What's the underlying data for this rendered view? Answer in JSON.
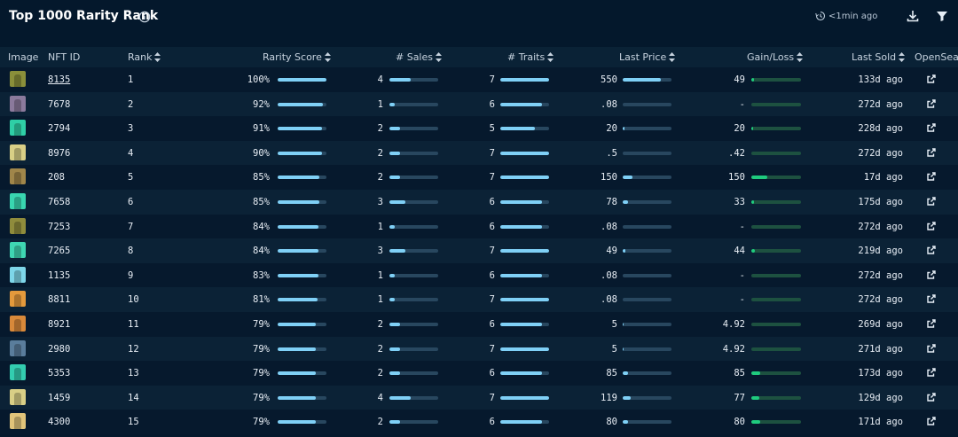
{
  "header": {
    "title": "Top 1000 Rarity Rank",
    "updated": "<1min ago",
    "icons": [
      "info-icon",
      "clock-refresh-icon",
      "download-icon",
      "filter-icon"
    ]
  },
  "columns": [
    "Image",
    "NFT ID",
    "Rank",
    "Rarity Score",
    "# Sales",
    "# Traits",
    "Last Price",
    "Gain/Loss",
    "Last Sold",
    "OpenSea"
  ],
  "colors": {
    "accent_bar": "#7fd0f6",
    "gain_bar": "#1fcb7e",
    "background": "#04182c"
  },
  "rows": [
    {
      "thumb": "#8a8f3a",
      "nft_id": "8135",
      "rank": "1",
      "score": "100%",
      "score_f": 1.0,
      "sales": "4",
      "sales_f": 0.44,
      "traits": "7",
      "traits_f": 1.0,
      "price": "550",
      "price_f": 0.78,
      "gain": "49",
      "gain_f": 0.06,
      "sold": "133d ago"
    },
    {
      "thumb": "#8b7a9c",
      "nft_id": "7678",
      "rank": "2",
      "score": "92%",
      "score_f": 0.92,
      "sales": "1",
      "sales_f": 0.11,
      "traits": "6",
      "traits_f": 0.86,
      "price": ".08",
      "price_f": 0.0,
      "gain": "-",
      "gain_f": 0.0,
      "sold": "272d ago"
    },
    {
      "thumb": "#2fcfa6",
      "nft_id": "2794",
      "rank": "3",
      "score": "91%",
      "score_f": 0.91,
      "sales": "2",
      "sales_f": 0.22,
      "traits": "5",
      "traits_f": 0.71,
      "price": "20",
      "price_f": 0.03,
      "gain": "20",
      "gain_f": 0.03,
      "sold": "228d ago"
    },
    {
      "thumb": "#d9cf86",
      "nft_id": "8976",
      "rank": "4",
      "score": "90%",
      "score_f": 0.9,
      "sales": "2",
      "sales_f": 0.22,
      "traits": "7",
      "traits_f": 1.0,
      "price": ".5",
      "price_f": 0.0,
      "gain": ".42",
      "gain_f": 0.0,
      "sold": "272d ago"
    },
    {
      "thumb": "#a0864a",
      "nft_id": "208",
      "rank": "5",
      "score": "85%",
      "score_f": 0.85,
      "sales": "2",
      "sales_f": 0.22,
      "traits": "7",
      "traits_f": 1.0,
      "price": "150",
      "price_f": 0.2,
      "gain": "150",
      "gain_f": 0.32,
      "sold": "17d ago"
    },
    {
      "thumb": "#39d6b0",
      "nft_id": "7658",
      "rank": "6",
      "score": "85%",
      "score_f": 0.85,
      "sales": "3",
      "sales_f": 0.33,
      "traits": "6",
      "traits_f": 0.86,
      "price": "78",
      "price_f": 0.1,
      "gain": "33",
      "gain_f": 0.05,
      "sold": "175d ago"
    },
    {
      "thumb": "#8f8c3c",
      "nft_id": "7253",
      "rank": "7",
      "score": "84%",
      "score_f": 0.84,
      "sales": "1",
      "sales_f": 0.11,
      "traits": "6",
      "traits_f": 0.86,
      "price": ".08",
      "price_f": 0.0,
      "gain": "-",
      "gain_f": 0.0,
      "sold": "272d ago"
    },
    {
      "thumb": "#3fd6b2",
      "nft_id": "7265",
      "rank": "8",
      "score": "84%",
      "score_f": 0.84,
      "sales": "3",
      "sales_f": 0.33,
      "traits": "7",
      "traits_f": 1.0,
      "price": "49",
      "price_f": 0.06,
      "gain": "44",
      "gain_f": 0.07,
      "sold": "219d ago"
    },
    {
      "thumb": "#7ed6e9",
      "nft_id": "1135",
      "rank": "9",
      "score": "83%",
      "score_f": 0.83,
      "sales": "1",
      "sales_f": 0.11,
      "traits": "6",
      "traits_f": 0.86,
      "price": ".08",
      "price_f": 0.0,
      "gain": "-",
      "gain_f": 0.0,
      "sold": "272d ago"
    },
    {
      "thumb": "#e49a3c",
      "nft_id": "8811",
      "rank": "10",
      "score": "81%",
      "score_f": 0.81,
      "sales": "1",
      "sales_f": 0.11,
      "traits": "7",
      "traits_f": 1.0,
      "price": ".08",
      "price_f": 0.0,
      "gain": "-",
      "gain_f": 0.0,
      "sold": "272d ago"
    },
    {
      "thumb": "#d8893a",
      "nft_id": "8921",
      "rank": "11",
      "score": "79%",
      "score_f": 0.79,
      "sales": "2",
      "sales_f": 0.22,
      "traits": "6",
      "traits_f": 0.86,
      "price": "5",
      "price_f": 0.01,
      "gain": "4.92",
      "gain_f": 0.0,
      "sold": "269d ago"
    },
    {
      "thumb": "#5a7d9c",
      "nft_id": "2980",
      "rank": "12",
      "score": "79%",
      "score_f": 0.79,
      "sales": "2",
      "sales_f": 0.22,
      "traits": "7",
      "traits_f": 1.0,
      "price": "5",
      "price_f": 0.01,
      "gain": "4.92",
      "gain_f": 0.0,
      "sold": "271d ago"
    },
    {
      "thumb": "#33cdb0",
      "nft_id": "5353",
      "rank": "13",
      "score": "79%",
      "score_f": 0.79,
      "sales": "2",
      "sales_f": 0.22,
      "traits": "6",
      "traits_f": 0.86,
      "price": "85",
      "price_f": 0.11,
      "gain": "85",
      "gain_f": 0.18,
      "sold": "173d ago"
    },
    {
      "thumb": "#d9cf86",
      "nft_id": "1459",
      "rank": "14",
      "score": "79%",
      "score_f": 0.79,
      "sales": "4",
      "sales_f": 0.44,
      "traits": "7",
      "traits_f": 1.0,
      "price": "119",
      "price_f": 0.16,
      "gain": "77",
      "gain_f": 0.16,
      "sold": "129d ago"
    },
    {
      "thumb": "#e1c47a",
      "nft_id": "4300",
      "rank": "15",
      "score": "79%",
      "score_f": 0.79,
      "sales": "2",
      "sales_f": 0.22,
      "traits": "6",
      "traits_f": 0.86,
      "price": "80",
      "price_f": 0.1,
      "gain": "80",
      "gain_f": 0.17,
      "sold": "171d ago"
    }
  ]
}
